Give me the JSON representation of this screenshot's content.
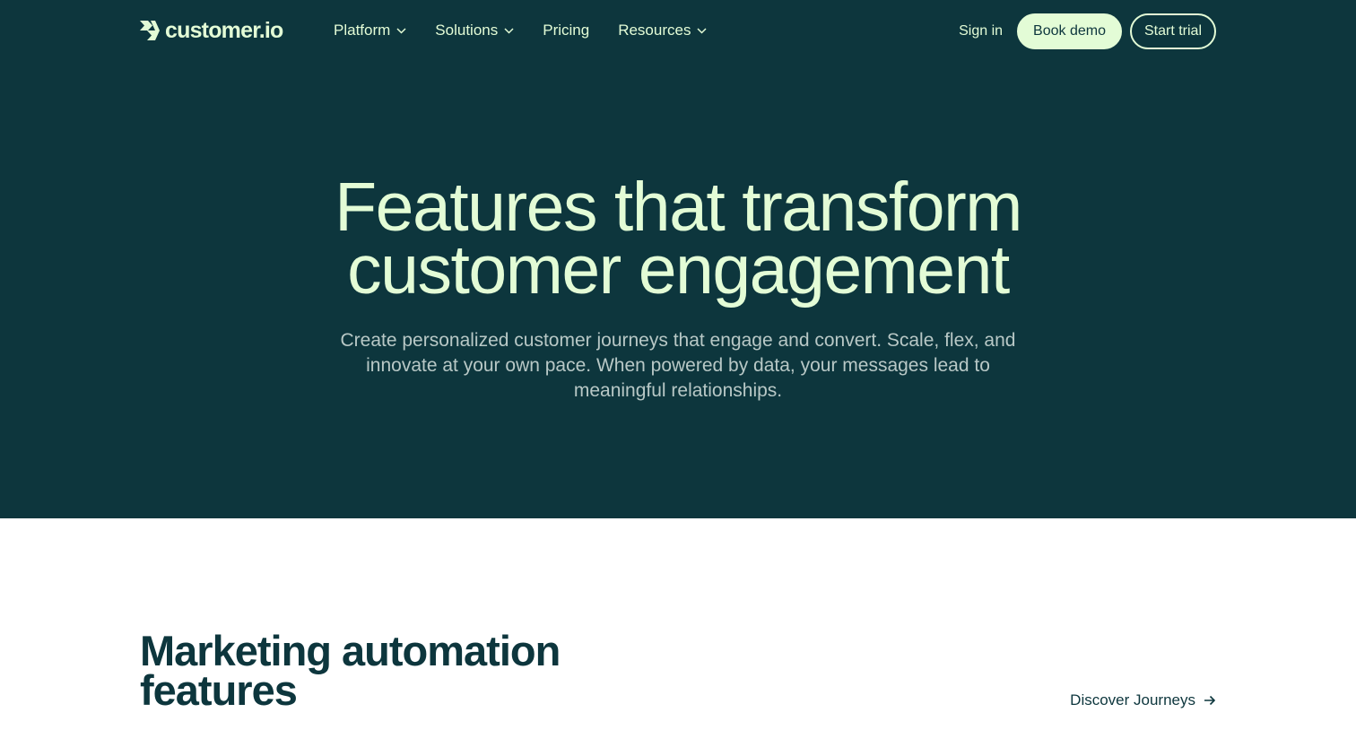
{
  "brand": {
    "name": "customer.io",
    "accent": "#e3fcd6",
    "dark": "#0d363d"
  },
  "nav": {
    "items": [
      {
        "label": "Platform",
        "dropdown": true
      },
      {
        "label": "Solutions",
        "dropdown": true
      },
      {
        "label": "Pricing",
        "dropdown": false
      },
      {
        "label": "Resources",
        "dropdown": true
      }
    ],
    "sign_in": "Sign in",
    "book_demo": "Book demo",
    "start_trial": "Start trial"
  },
  "hero": {
    "title_line1": "Features that transform",
    "title_line2": "customer engagement",
    "subtitle": "Create personalized customer journeys that engage and convert. Scale, flex, and innovate at your own pace. When powered by data, your messages lead to meaningful relationships."
  },
  "section": {
    "title": "Marketing automation features",
    "link": "Discover Journeys",
    "link_icon": "arrow-right-icon"
  }
}
